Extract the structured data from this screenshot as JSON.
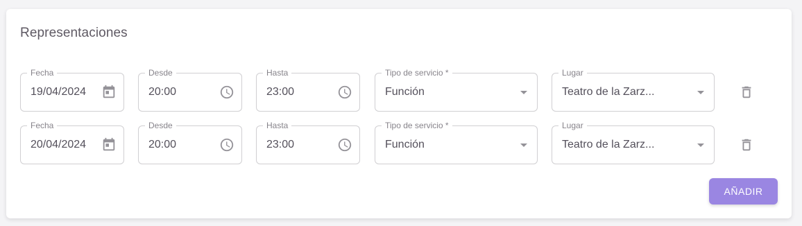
{
  "section": {
    "title": "Representaciones"
  },
  "rows": [
    {
      "fecha": {
        "label": "Fecha",
        "value": "19/04/2024"
      },
      "desde": {
        "label": "Desde",
        "value": "20:00"
      },
      "hasta": {
        "label": "Hasta",
        "value": "23:00"
      },
      "tipo": {
        "label": "Tipo de servicio *",
        "value": "Función"
      },
      "lugar": {
        "label": "Lugar",
        "value": "Teatro de la Zarz..."
      }
    },
    {
      "fecha": {
        "label": "Fecha",
        "value": "20/04/2024"
      },
      "desde": {
        "label": "Desde",
        "value": "20:00"
      },
      "hasta": {
        "label": "Hasta",
        "value": "23:00"
      },
      "tipo": {
        "label": "Tipo de servicio *",
        "value": "Función"
      },
      "lugar": {
        "label": "Lugar",
        "value": "Teatro de la Zarz..."
      }
    }
  ],
  "actions": {
    "add_label": "AÑADIR"
  },
  "icons": {
    "date": "calendar-icon",
    "time": "clock-icon",
    "select": "chevron-down-icon",
    "delete": "trash-icon"
  },
  "colors": {
    "accent": "#9a86e2",
    "text": "#3a3541",
    "background": "#f4f4f6"
  }
}
